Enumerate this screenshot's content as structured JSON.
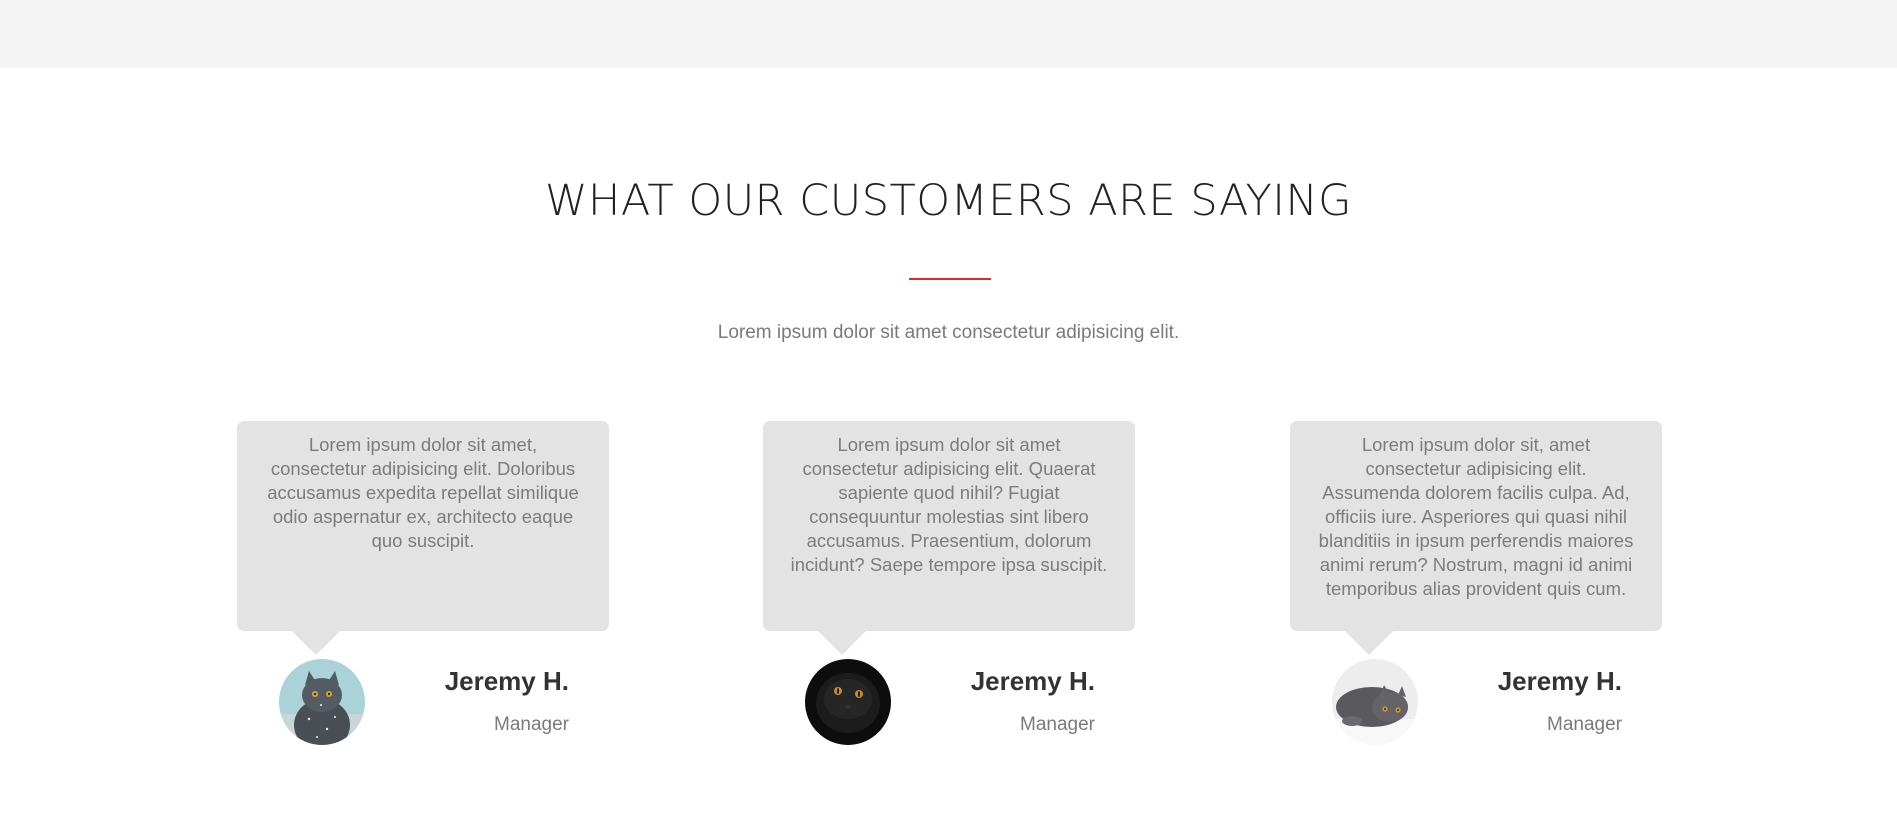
{
  "section": {
    "heading": "WHAT OUR CUSTOMERS ARE SAYING",
    "subtitle": "Lorem ipsum dolor sit amet consectetur adipisicing elit.",
    "accent_color": "#d32f2f"
  },
  "testimonials": [
    {
      "quote": "Lorem ipsum dolor sit amet, consectetur adipisicing elit. Doloribus accusamus expedita repellat similique odio aspernatur ex, architecto eaque quo suscipit.",
      "name": "Jeremy H.",
      "role": "Manager",
      "avatar": "cat-photo-snowy-grey"
    },
    {
      "quote": "Lorem ipsum dolor sit amet consectetur adipisicing elit. Quaerat sapiente quod nihil? Fugiat consequuntur molestias sint libero accusamus. Praesentium, dolorum incidunt? Saepe tempore ipsa suscipit.",
      "name": "Jeremy H.",
      "role": "Manager",
      "avatar": "cat-photo-black"
    },
    {
      "quote": "Lorem ipsum dolor sit, amet consectetur adipisicing elit. Assumenda dolorem facilis culpa. Ad, officiis iure. Asperiores qui quasi nihil blanditiis in ipsum perferendis maiores animi rerum? Nostrum, magni id animi temporibus alias provident quis cum.",
      "name": "Jeremy H.",
      "role": "Manager",
      "avatar": "cat-photo-grey-lying"
    }
  ]
}
